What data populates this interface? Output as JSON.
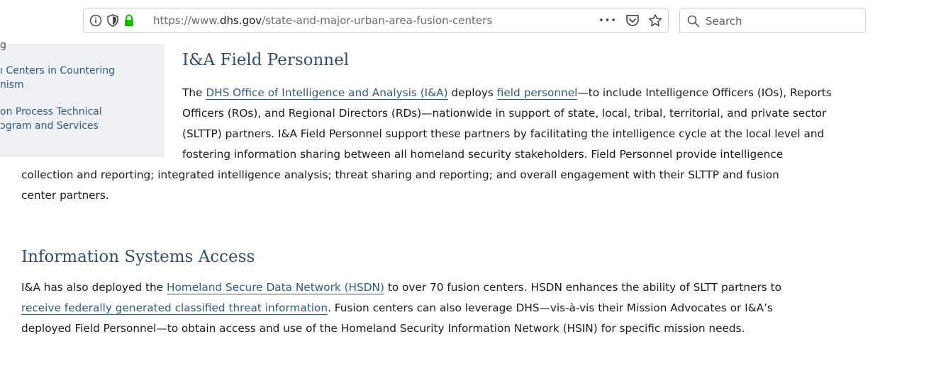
{
  "browser": {
    "url_prefix": "https://www.",
    "url_domain": "dhs.gov",
    "url_path": "/state-and-major-urban-area-fusion-centers",
    "more_label": "•••",
    "search_placeholder": "Search"
  },
  "sidebar": {
    "top_fragment": "g",
    "items": [
      {
        "line1": "ı Centers in Countering",
        "line2": "nism"
      },
      {
        "line1": "on Process Technical",
        "line2": "ɔgram and Services"
      }
    ]
  },
  "sections": {
    "field": {
      "title": "I&A Field Personnel",
      "l1_a": "The ",
      "l1_link1": "DHS Office of Intelligence and Analysis (I&A)",
      "l1_b": " deploys ",
      "l1_link2": "field personnel",
      "l1_c": "—to include Intelligence Officers (IOs), Reports",
      "l2": "Officers (ROs), and Regional Directors (RDs)—nationwide in support of state, local, tribal, territorial, and private sector",
      "l3": "(SLTTP) partners. I&A Field Personnel support these partners by facilitating the intelligence cycle at the local level and",
      "l4": "fostering information sharing between all homeland security stakeholders. Field Personnel provide intelligence",
      "l5": "collection and reporting; integrated intelligence analysis; threat sharing and reporting; and overall engagement with their SLTTP and fusion",
      "l6": "center partners."
    },
    "systems": {
      "title": "Information Systems Access",
      "l1_a": "I&A has also deployed the ",
      "l1_link": "Homeland Secure Data Network (HSDN)",
      "l1_b": " to over 70 fusion centers. HSDN enhances the ability of SLTT partners to",
      "l2_link": "receive federally generated classified threat information",
      "l2_b": ". Fusion centers can also leverage DHS—vis-à-vis their Mission Advocates or I&A’s",
      "l3": "deployed Field Personnel—to obtain access and use of the Homeland Security Information Network (HSIN) for specific mission needs."
    }
  }
}
